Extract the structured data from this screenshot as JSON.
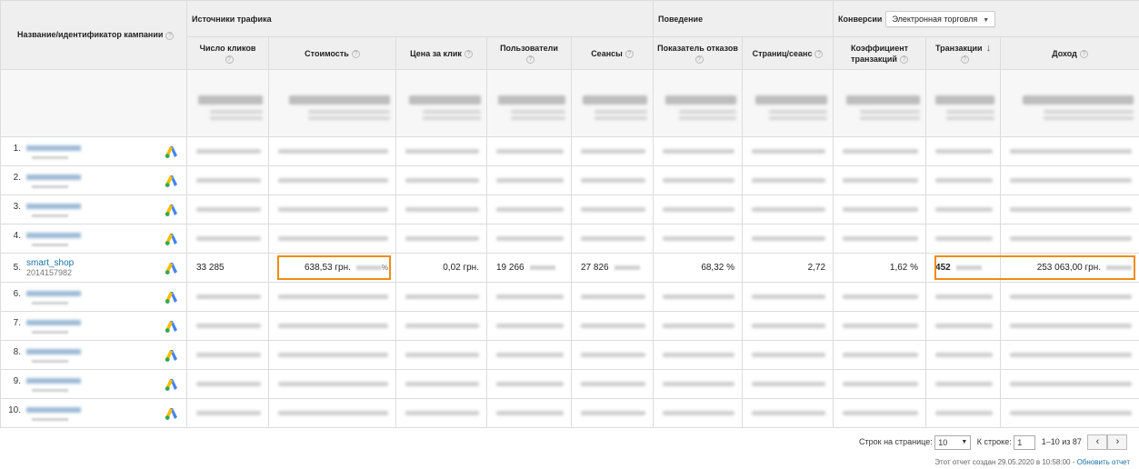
{
  "header": {
    "campaign_col": "Название/идентификатор кампании",
    "group_traffic": "Источники трафика",
    "group_behavior": "Поведение",
    "group_conversions": "Конверсии",
    "conversion_select": "Электронная торговля",
    "columns": [
      "Число кликов",
      "Стоимость",
      "Цена за клик",
      "Пользователи",
      "Сеансы",
      "Показатель отказов",
      "Страниц/сеанс",
      "Коэффициент транзакций",
      "Транзакции",
      "Доход"
    ]
  },
  "rows": [
    {
      "n": "1."
    },
    {
      "n": "2."
    },
    {
      "n": "3."
    },
    {
      "n": "4."
    },
    {
      "n": "5.",
      "campaign": "smart_shop",
      "campaign_id": "2014157982",
      "clicks": "33 285",
      "cost": "638,53 грн.",
      "cost_pct": "%",
      "cpc": "0,02 грн.",
      "users": "19 266",
      "sessions": "27 826",
      "bounce": "68,32 %",
      "pages": "2,72",
      "conv_rate": "1,62 %",
      "transactions": "452",
      "revenue": "253 063,00 грн."
    },
    {
      "n": "6."
    },
    {
      "n": "7."
    },
    {
      "n": "8."
    },
    {
      "n": "9."
    },
    {
      "n": "10."
    }
  ],
  "footer": {
    "rows_per_page_label": "Строк на странице:",
    "rows_per_page": "10",
    "go_to_label": "К строке:",
    "go_to_value": "1",
    "range": "1–10 из 87",
    "prev": "‹",
    "next": "›",
    "created_text": "Этот отчет создан 29.05.2020 в 10:58:00 - ",
    "refresh_link": "Обновить отчет"
  },
  "colors": {
    "highlight": "#f08c13",
    "link": "#1a73a8"
  }
}
